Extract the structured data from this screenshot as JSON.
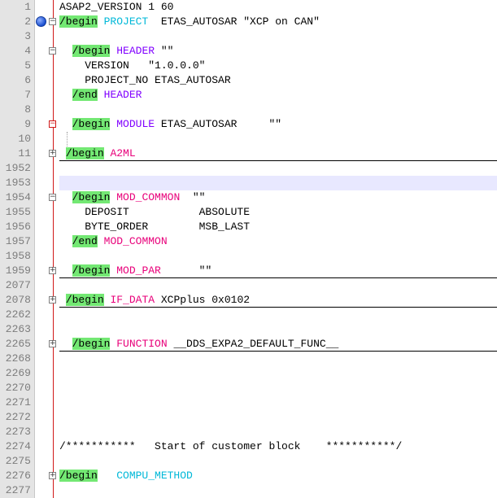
{
  "lines": [
    {
      "n": "1",
      "parts": [
        {
          "t": "ASAP2_VERSION 1 60",
          "c": ""
        }
      ]
    },
    {
      "n": "2",
      "parts": [
        {
          "t": "/begin",
          "c": "hl"
        },
        {
          "t": " ",
          "c": ""
        },
        {
          "t": "PROJECT",
          "c": "kw3"
        },
        {
          "t": "  ETAS_AUTOSAR \"XCP on CAN\"",
          "c": ""
        }
      ],
      "bookmark": true,
      "fold": "minus"
    },
    {
      "n": "3",
      "parts": []
    },
    {
      "n": "4",
      "parts": [
        {
          "t": "  ",
          "c": ""
        },
        {
          "t": "/begin",
          "c": "hl"
        },
        {
          "t": " ",
          "c": ""
        },
        {
          "t": "HEADER",
          "c": "kw"
        },
        {
          "t": " \"\"",
          "c": ""
        }
      ],
      "fold": "minus"
    },
    {
      "n": "5",
      "parts": [
        {
          "t": "    VERSION   \"1.0.0.0\"",
          "c": ""
        }
      ]
    },
    {
      "n": "6",
      "parts": [
        {
          "t": "    PROJECT_NO ETAS_AUTOSAR",
          "c": ""
        }
      ]
    },
    {
      "n": "7",
      "parts": [
        {
          "t": "  ",
          "c": ""
        },
        {
          "t": "/end",
          "c": "hl"
        },
        {
          "t": " ",
          "c": ""
        },
        {
          "t": "HEADER",
          "c": "kw"
        }
      ]
    },
    {
      "n": "8",
      "parts": []
    },
    {
      "n": "9",
      "parts": [
        {
          "t": "  ",
          "c": ""
        },
        {
          "t": "/begin",
          "c": "hl"
        },
        {
          "t": " ",
          "c": ""
        },
        {
          "t": "MODULE",
          "c": "kw"
        },
        {
          "t": " ETAS_AUTOSAR     \"\"",
          "c": ""
        }
      ],
      "fold": "minus-red"
    },
    {
      "n": "10",
      "parts": [],
      "dots": true
    },
    {
      "n": "11",
      "parts": [
        {
          "t": " ",
          "c": ""
        },
        {
          "t": "/begin",
          "c": "hl"
        },
        {
          "t": " ",
          "c": ""
        },
        {
          "t": "A2ML",
          "c": "kw2"
        }
      ],
      "fold": "plus",
      "underline": true
    },
    {
      "n": "1952",
      "parts": []
    },
    {
      "n": "1953",
      "parts": [],
      "current": true
    },
    {
      "n": "1954",
      "parts": [
        {
          "t": "  ",
          "c": ""
        },
        {
          "t": "/begin",
          "c": "hl"
        },
        {
          "t": " ",
          "c": ""
        },
        {
          "t": "MOD_COMMON",
          "c": "kw2"
        },
        {
          "t": "  \"\"",
          "c": ""
        }
      ],
      "fold": "minus"
    },
    {
      "n": "1955",
      "parts": [
        {
          "t": "    DEPOSIT           ABSOLUTE",
          "c": ""
        }
      ]
    },
    {
      "n": "1956",
      "parts": [
        {
          "t": "    BYTE_ORDER        MSB_LAST",
          "c": ""
        }
      ]
    },
    {
      "n": "1957",
      "parts": [
        {
          "t": "  ",
          "c": ""
        },
        {
          "t": "/end",
          "c": "hl"
        },
        {
          "t": " ",
          "c": ""
        },
        {
          "t": "MOD_COMMON",
          "c": "kw2"
        }
      ]
    },
    {
      "n": "1958",
      "parts": []
    },
    {
      "n": "1959",
      "parts": [
        {
          "t": "  ",
          "c": ""
        },
        {
          "t": "/begin",
          "c": "hl"
        },
        {
          "t": " ",
          "c": ""
        },
        {
          "t": "MOD_PAR",
          "c": "kw2"
        },
        {
          "t": "      \"\"",
          "c": ""
        }
      ],
      "fold": "plus",
      "underline": true
    },
    {
      "n": "2077",
      "parts": []
    },
    {
      "n": "2078",
      "parts": [
        {
          "t": " ",
          "c": ""
        },
        {
          "t": "/begin",
          "c": "hl"
        },
        {
          "t": " ",
          "c": ""
        },
        {
          "t": "IF_DATA",
          "c": "kw2"
        },
        {
          "t": " XCPplus 0x0102",
          "c": ""
        }
      ],
      "fold": "plus",
      "underline": true
    },
    {
      "n": "2262",
      "parts": []
    },
    {
      "n": "2263",
      "parts": []
    },
    {
      "n": "2265",
      "parts": [
        {
          "t": "  ",
          "c": ""
        },
        {
          "t": "/begin",
          "c": "hl"
        },
        {
          "t": " ",
          "c": ""
        },
        {
          "t": "FUNCTION",
          "c": "kw2"
        },
        {
          "t": " __DDS_EXPA2_DEFAULT_FUNC__",
          "c": ""
        }
      ],
      "fold": "plus",
      "underline": true
    },
    {
      "n": "2268",
      "parts": []
    },
    {
      "n": "2269",
      "parts": []
    },
    {
      "n": "2270",
      "parts": []
    },
    {
      "n": "2271",
      "parts": []
    },
    {
      "n": "2272",
      "parts": []
    },
    {
      "n": "2273",
      "parts": []
    },
    {
      "n": "2274",
      "parts": [
        {
          "t": "/***********   Start of customer block    ***********/",
          "c": ""
        }
      ]
    },
    {
      "n": "2275",
      "parts": []
    },
    {
      "n": "2276",
      "parts": [
        {
          "t": "/begin",
          "c": "hl"
        },
        {
          "t": "   ",
          "c": ""
        },
        {
          "t": "COMPU_METHOD",
          "c": "kw3"
        }
      ],
      "fold": "plus"
    },
    {
      "n": "2277",
      "parts": []
    }
  ]
}
